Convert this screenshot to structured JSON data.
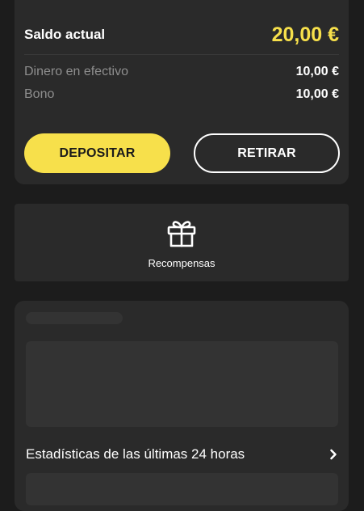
{
  "balance": {
    "label": "Saldo actual",
    "amount": "20,00 €",
    "cash_label": "Dinero en efectivo",
    "cash_amount": "10,00 €",
    "bonus_label": "Bono",
    "bonus_amount": "10,00 €"
  },
  "actions": {
    "deposit_label": "DEPOSITAR",
    "withdraw_label": "RETIRAR"
  },
  "rewards": {
    "label": "Recompensas",
    "icon": "gift-icon"
  },
  "stats": {
    "label": "Estadísticas de las últimas 24 horas",
    "icon": "chevron-right-icon"
  },
  "colors": {
    "accent": "#f7e04b",
    "background": "#1c1c1c",
    "card": "#2a2a2a"
  }
}
